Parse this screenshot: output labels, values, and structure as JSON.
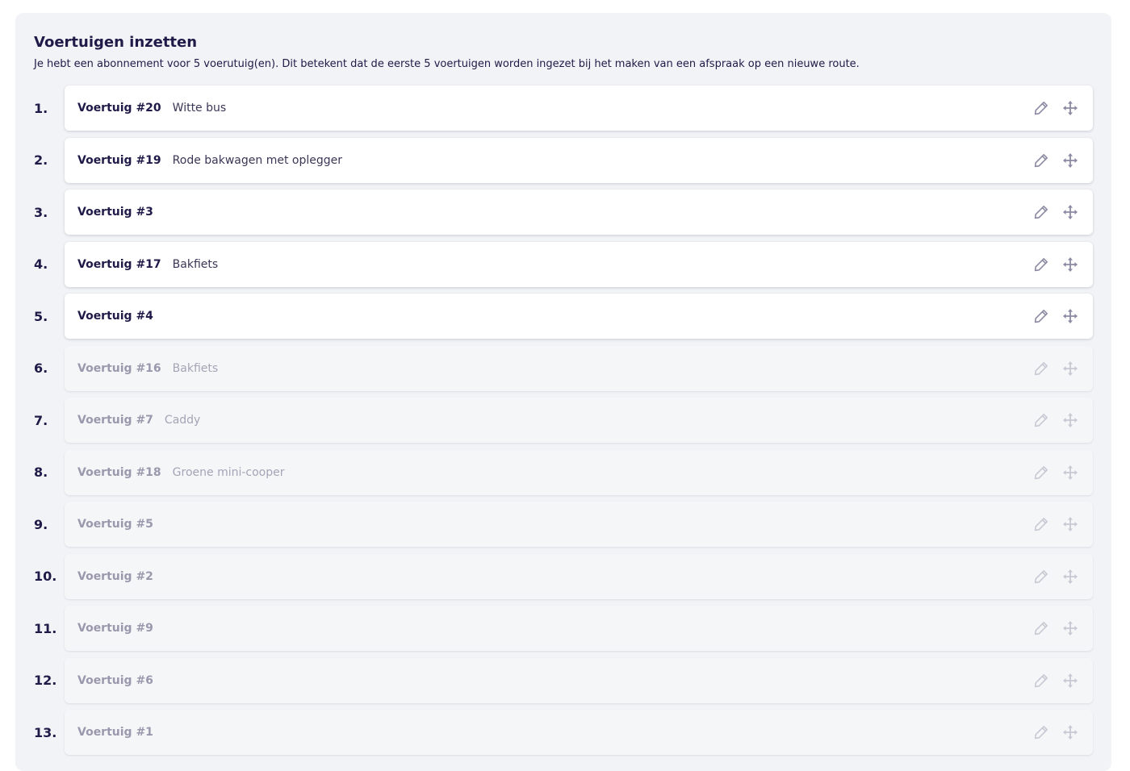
{
  "section": {
    "title": "Voertuigen inzetten",
    "intro": "Je hebt een abonnement voor 5 voerutuig(en). Dit betekent dat de eerste 5 voertuigen worden ingezet bij het maken van een afspraak op een nieuwe route."
  },
  "vehicles": [
    {
      "number": "1.",
      "name": "Voertuig #20",
      "description": "Witte bus",
      "active": true
    },
    {
      "number": "2.",
      "name": "Voertuig #19",
      "description": "Rode bakwagen met oplegger",
      "active": true
    },
    {
      "number": "3.",
      "name": "Voertuig #3",
      "description": "",
      "active": true
    },
    {
      "number": "4.",
      "name": "Voertuig #17",
      "description": "Bakfiets",
      "active": true
    },
    {
      "number": "5.",
      "name": "Voertuig #4",
      "description": "",
      "active": true
    },
    {
      "number": "6.",
      "name": "Voertuig #16",
      "description": "Bakfiets",
      "active": false
    },
    {
      "number": "7.",
      "name": "Voertuig #7",
      "description": "Caddy",
      "active": false
    },
    {
      "number": "8.",
      "name": "Voertuig #18",
      "description": "Groene mini-cooper",
      "active": false
    },
    {
      "number": "9.",
      "name": "Voertuig #5",
      "description": "",
      "active": false
    },
    {
      "number": "10.",
      "name": "Voertuig #2",
      "description": "",
      "active": false
    },
    {
      "number": "11.",
      "name": "Voertuig #9",
      "description": "",
      "active": false
    },
    {
      "number": "12.",
      "name": "Voertuig #6",
      "description": "",
      "active": false
    },
    {
      "number": "13.",
      "name": "Voertuig #1",
      "description": "",
      "active": false
    }
  ],
  "icons": {
    "edit": "pencil-icon",
    "move": "drag-move-icon"
  },
  "colors": {
    "text_primary": "#1f1a48",
    "text_muted": "#9b98ad",
    "panel_background": "#f2f3f6",
    "card_active": "#ffffff",
    "card_inactive": "#f5f6f8"
  }
}
